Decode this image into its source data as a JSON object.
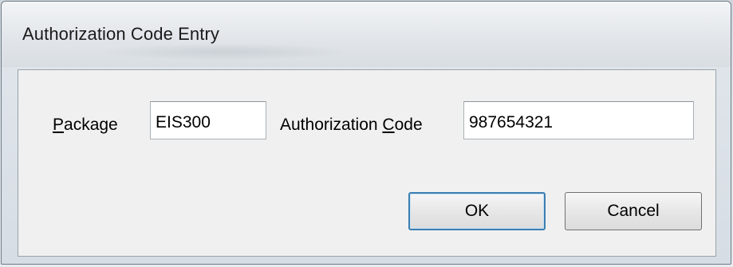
{
  "dialog": {
    "title": "Authorization Code Entry"
  },
  "form": {
    "package_label_mnemonic": "P",
    "package_label_rest": "ackage",
    "package_value": "EIS300",
    "auth_label_pre": "Authorization ",
    "auth_label_mnemonic": "C",
    "auth_label_rest": "ode",
    "auth_value": "987654321"
  },
  "buttons": {
    "ok_label": "OK",
    "cancel_label": "Cancel"
  }
}
